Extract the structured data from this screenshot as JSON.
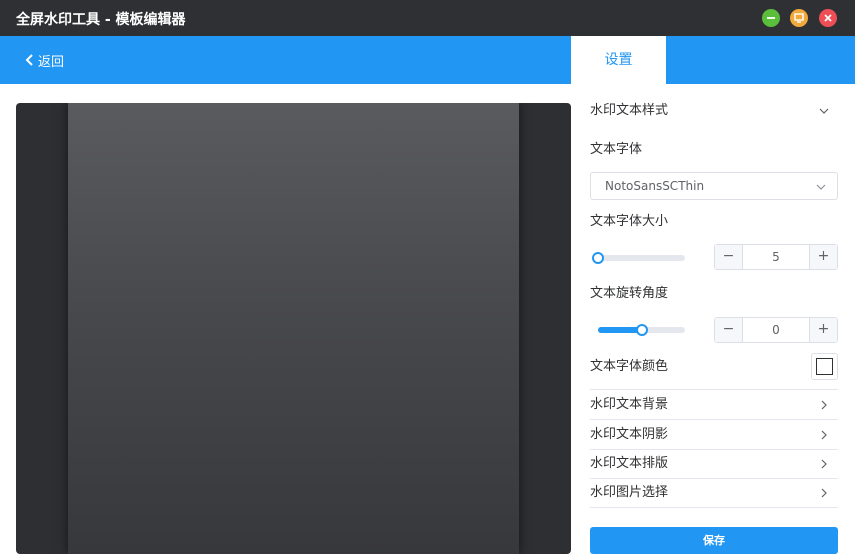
{
  "window": {
    "title": "全屏水印工具 - 模板编辑器",
    "minimize_icon": "minimize-icon",
    "maximize_icon": "maximize-icon",
    "close_icon": "close-icon",
    "colors": {
      "minimize": "#5bbd3c",
      "maximize": "#f2a93b",
      "close": "#ee4f57"
    }
  },
  "nav": {
    "back_label": "返回",
    "settings_tab": "设置",
    "accent": "#2196f3"
  },
  "panel": {
    "text_style_section": "水印文本样式",
    "font_label": "文本字体",
    "font_value": "NotoSansSCThin",
    "font_size_label": "文本字体大小",
    "font_size": {
      "value": "5",
      "slider_fraction": 0.0,
      "decrement": "−",
      "increment": "+"
    },
    "rotation_label": "文本旋转角度",
    "rotation": {
      "value": "0",
      "slider_fraction": 0.5,
      "decrement": "−",
      "increment": "+"
    },
    "color_label": "文本字体颜色",
    "color_value": "#ffffff",
    "sections": [
      {
        "label": "水印文本背景"
      },
      {
        "label": "水印文本阴影"
      },
      {
        "label": "水印文本排版"
      },
      {
        "label": "水印图片选择"
      }
    ],
    "save_label": "保存"
  }
}
